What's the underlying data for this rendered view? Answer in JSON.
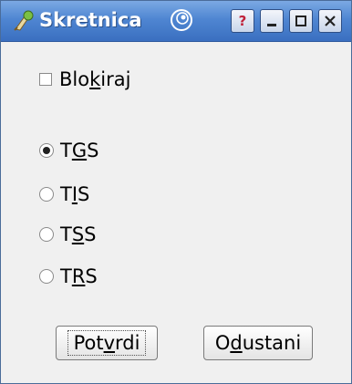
{
  "window": {
    "title": "Skretnica",
    "help_glyph": "?",
    "minimize_glyph": "_",
    "maximize_glyph": "□",
    "close_glyph": "×"
  },
  "checkbox": {
    "label_pre": "Blo",
    "label_mnemonic": "k",
    "label_post": "iraj",
    "checked": false
  },
  "options": [
    {
      "pre": "T",
      "mnemonic": "G",
      "post": "S",
      "selected": true
    },
    {
      "pre": "T",
      "mnemonic": "I",
      "post": "S",
      "selected": false
    },
    {
      "pre": "T",
      "mnemonic": "S",
      "post": "S",
      "selected": false
    },
    {
      "pre": "T",
      "mnemonic": "R",
      "post": "S",
      "selected": false
    }
  ],
  "buttons": {
    "confirm": {
      "pre": "Pot",
      "mnemonic": "v",
      "post": "rdi"
    },
    "cancel": {
      "pre": "O",
      "mnemonic": "d",
      "post": "ustani"
    }
  }
}
